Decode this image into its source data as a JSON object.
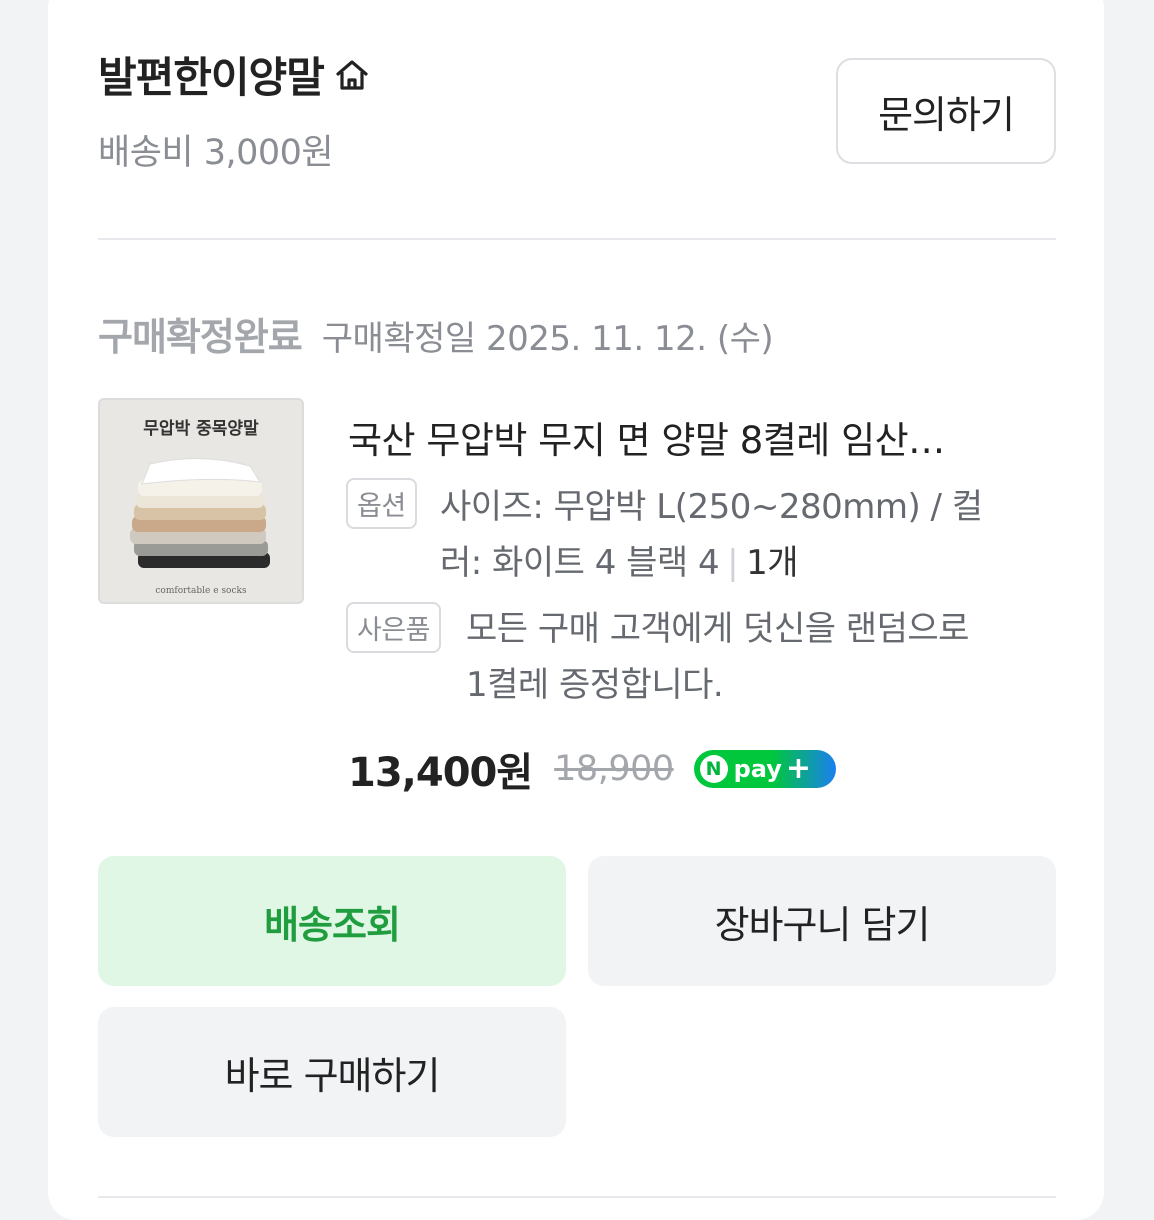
{
  "store": {
    "name": "발편한이양말",
    "home_icon": "home-icon",
    "shipping_fee": "배송비 3,000원",
    "inquiry_label": "문의하기"
  },
  "order": {
    "status": "구매확정완료",
    "confirm_date": "구매확정일 2025. 11. 12. (수)"
  },
  "product": {
    "image_title": "무압박 중목양말",
    "image_caption": "comfortable e socks",
    "title": "국산 무압박 무지 면 양말 8켤레 임산…",
    "option_badge": "옵션",
    "option_line1": "사이즈: 무압박 L(250~280mm) / 컬",
    "option_line2": "러: 화이트 4 블랙 4",
    "quantity": "1개",
    "gift_badge": "사은품",
    "gift_line1": "모든 구매 고객에게 덧신을 랜덤으로",
    "gift_line2": "1켤레 증정합니다.",
    "price": "13,400원",
    "original_price": "18,900",
    "npay_label": "pay",
    "npay_n": "N",
    "npay_plus": "+"
  },
  "actions": {
    "track_label": "배송조회",
    "cart_label": "장바구니 담기",
    "buy_label": "바로 구매하기"
  },
  "colors": {
    "track_bg": "#dff7e4",
    "track_text": "#1f9d3f",
    "npay_green": "#00c73c",
    "npay_blue": "#1a7ff0"
  }
}
